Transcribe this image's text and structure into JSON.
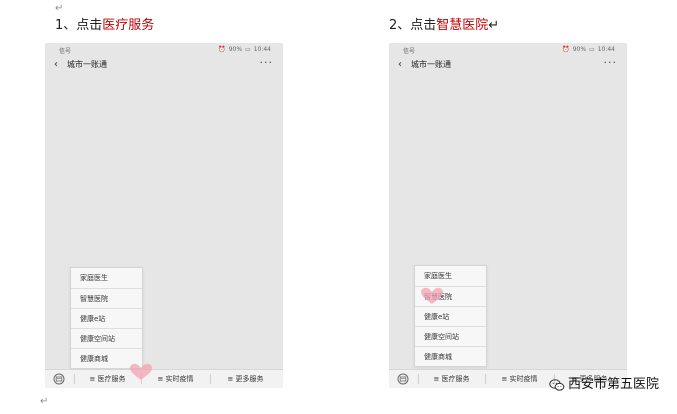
{
  "document": {
    "para_mark": "↵",
    "steps": [
      {
        "prefix": "1、点击",
        "highlight": "医疗服务",
        "suffix": ""
      },
      {
        "prefix": "2、点击",
        "highlight": "智慧医院",
        "suffix": "↵"
      }
    ],
    "phones": [
      {
        "status_left": "信号",
        "status_right_battery": "90%",
        "status_right_time": "10:44",
        "title": "城市一账通",
        "menu_items": [
          "家庭医生",
          "智慧医院",
          "健康e站",
          "健康空间站",
          "健康商城"
        ],
        "tabs": [
          "≡ 医疗服务",
          "≡ 实时疫情",
          "≡ 更多服务"
        ]
      },
      {
        "status_left": "信号",
        "status_right_battery": "90%",
        "status_right_time": "10:44",
        "title": "城市一账通",
        "menu_items": [
          "家庭医生",
          "智慧医院",
          "健康e站",
          "健康空间站",
          "健康商城"
        ],
        "tabs": [
          "≡ 医疗服务",
          "≡ 实时疫情",
          "≡ 更多服务"
        ]
      }
    ],
    "watermark": "西安市第五医院"
  },
  "colors": {
    "highlight": "#c00000",
    "phone_bg": "#e6e6e6",
    "heart": "#f2a3b3"
  },
  "icons": {
    "back": "back-arrow-icon",
    "more": "more-dots-icon",
    "keyboard": "keyboard-icon",
    "heart": "heart-icon",
    "watermark": "wechat-icon"
  }
}
